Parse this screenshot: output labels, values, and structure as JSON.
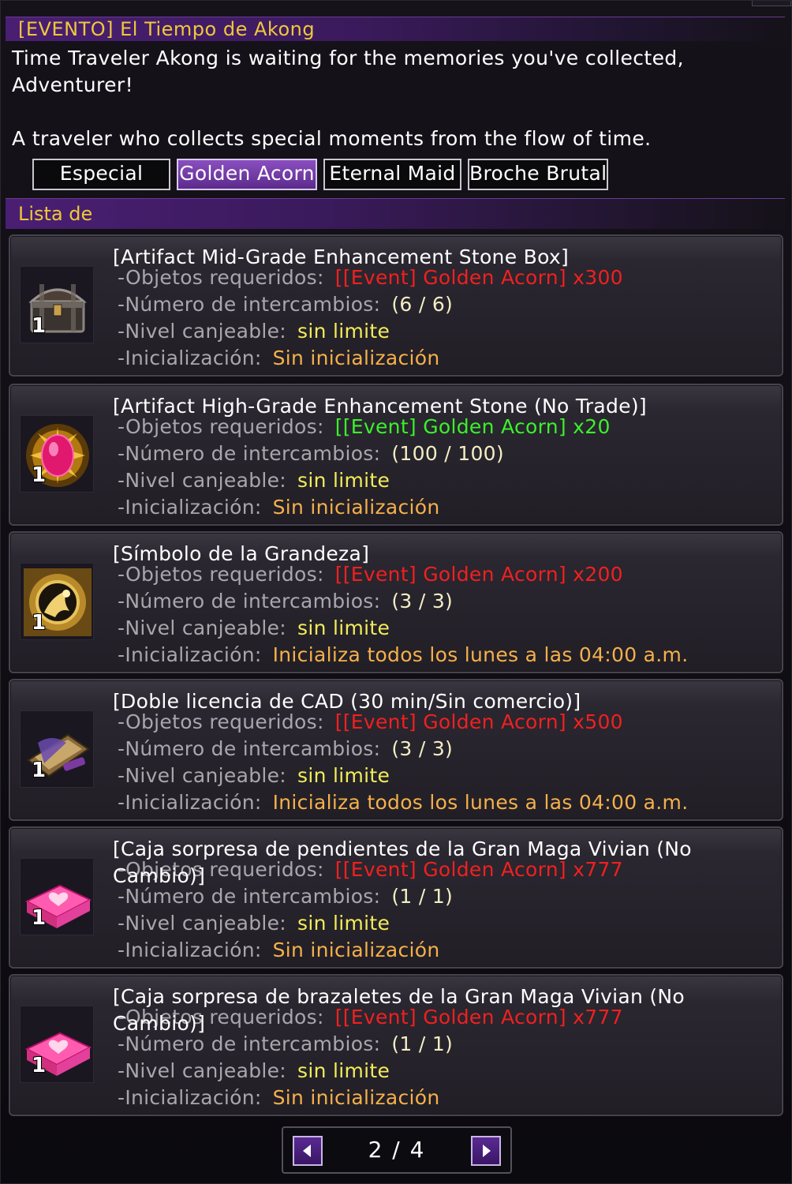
{
  "window": {
    "title": "[EVENTO] El Tiempo de Akong",
    "description_line1": "Time Traveler Akong is waiting for the memories you've collected,",
    "description_line2": "Adventurer!",
    "description_line3": "A traveler who collects special moments from the flow of time."
  },
  "tabs": [
    {
      "label": "Especial",
      "active": false
    },
    {
      "label": "Golden Acorn",
      "active": true
    },
    {
      "label": "Eternal Maid",
      "active": false
    },
    {
      "label": "Broche Brutal",
      "active": false
    }
  ],
  "list": {
    "header": "Lista de",
    "labels": {
      "required": "-Objetos requeridos:",
      "exchanges": "-Número de intercambios:",
      "level": "-Nivel canjeable:",
      "reset": "-Inicialización:"
    },
    "items": [
      {
        "icon": "treasure-chest-icon",
        "count": "1",
        "name": "[Artifact Mid-Grade Enhancement Stone Box]",
        "required": "[[Event] Golden Acorn] x300",
        "required_color": "#f02020",
        "exchanges": "(6 / 6)",
        "level": "sin limite",
        "reset": "Sin inicialización"
      },
      {
        "icon": "pink-gem-icon",
        "count": "1",
        "name": "[Artifact High-Grade Enhancement Stone (No Trade)]",
        "required": "[[Event] Golden Acorn] x20",
        "required_color": "#3cf02c",
        "exchanges": "(100 / 100)",
        "level": "sin limite",
        "reset": "Sin inicialización"
      },
      {
        "icon": "golden-emblem-icon",
        "count": "1",
        "name": "[Símbolo de la Grandeza]",
        "required": "[[Event] Golden Acorn] x200",
        "required_color": "#f02020",
        "exchanges": "(3 / 3)",
        "level": "sin limite",
        "reset": "Inicializa todos los lunes a las 04:00 a.m."
      },
      {
        "icon": "scroll-license-icon",
        "count": "1",
        "name": "[Doble licencia de CAD (30 min/Sin comercio)]",
        "required": "[[Event] Golden Acorn] x500",
        "required_color": "#f02020",
        "exchanges": "(3 / 3)",
        "level": "sin limite",
        "reset": "Inicializa todos los lunes a las 04:00 a.m."
      },
      {
        "icon": "pink-heart-box-icon",
        "count": "1",
        "name": "[Caja sorpresa de pendientes de la Gran Maga Vivian (No Cambio)]",
        "required": "[[Event] Golden Acorn] x777",
        "required_color": "#f02020",
        "exchanges": "(1 / 1)",
        "level": "sin limite",
        "reset": "Sin inicialización"
      },
      {
        "icon": "pink-heart-box-icon",
        "count": "1",
        "name": "[Caja sorpresa de brazaletes de la Gran Maga Vivian (No Cambio)]",
        "required": "[[Event] Golden Acorn] x777",
        "required_color": "#f02020",
        "exchanges": "(1 / 1)",
        "level": "sin limite",
        "reset": "Sin inicialización"
      }
    ]
  },
  "pager": {
    "text": "2 / 4",
    "prev_icon": "left-arrow-icon",
    "next_icon": "right-arrow-icon"
  }
}
